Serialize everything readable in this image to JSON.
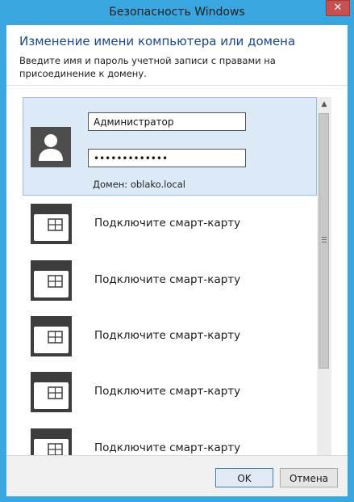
{
  "window": {
    "title": "Безопасность Windows",
    "close_glyph": "✕"
  },
  "header": {
    "title": "Изменение имени компьютера или домена",
    "description": "Введите имя и пароль учетной записи с правами на присоединение к домену."
  },
  "credential": {
    "username": "Администратор",
    "password_mask": "•••••••••••••",
    "domain_text": "Домен: oblako.local"
  },
  "smartcards": [
    {
      "label": "Подключите смарт-карту",
      "icon": "smart-card-icon"
    },
    {
      "label": "Подключите смарт-карту",
      "icon": "smart-card-icon"
    },
    {
      "label": "Подключите смарт-карту",
      "icon": "smart-card-icon"
    },
    {
      "label": "Подключите смарт-карту",
      "icon": "smart-card-icon"
    },
    {
      "label": "Подключите смарт-карту",
      "icon": "smart-card-icon"
    }
  ],
  "buttons": {
    "ok": "OK",
    "cancel": "Отмена"
  },
  "colors": {
    "frame": "#3aa6e0",
    "selection": "#dce9f7",
    "close": "#c75050"
  }
}
